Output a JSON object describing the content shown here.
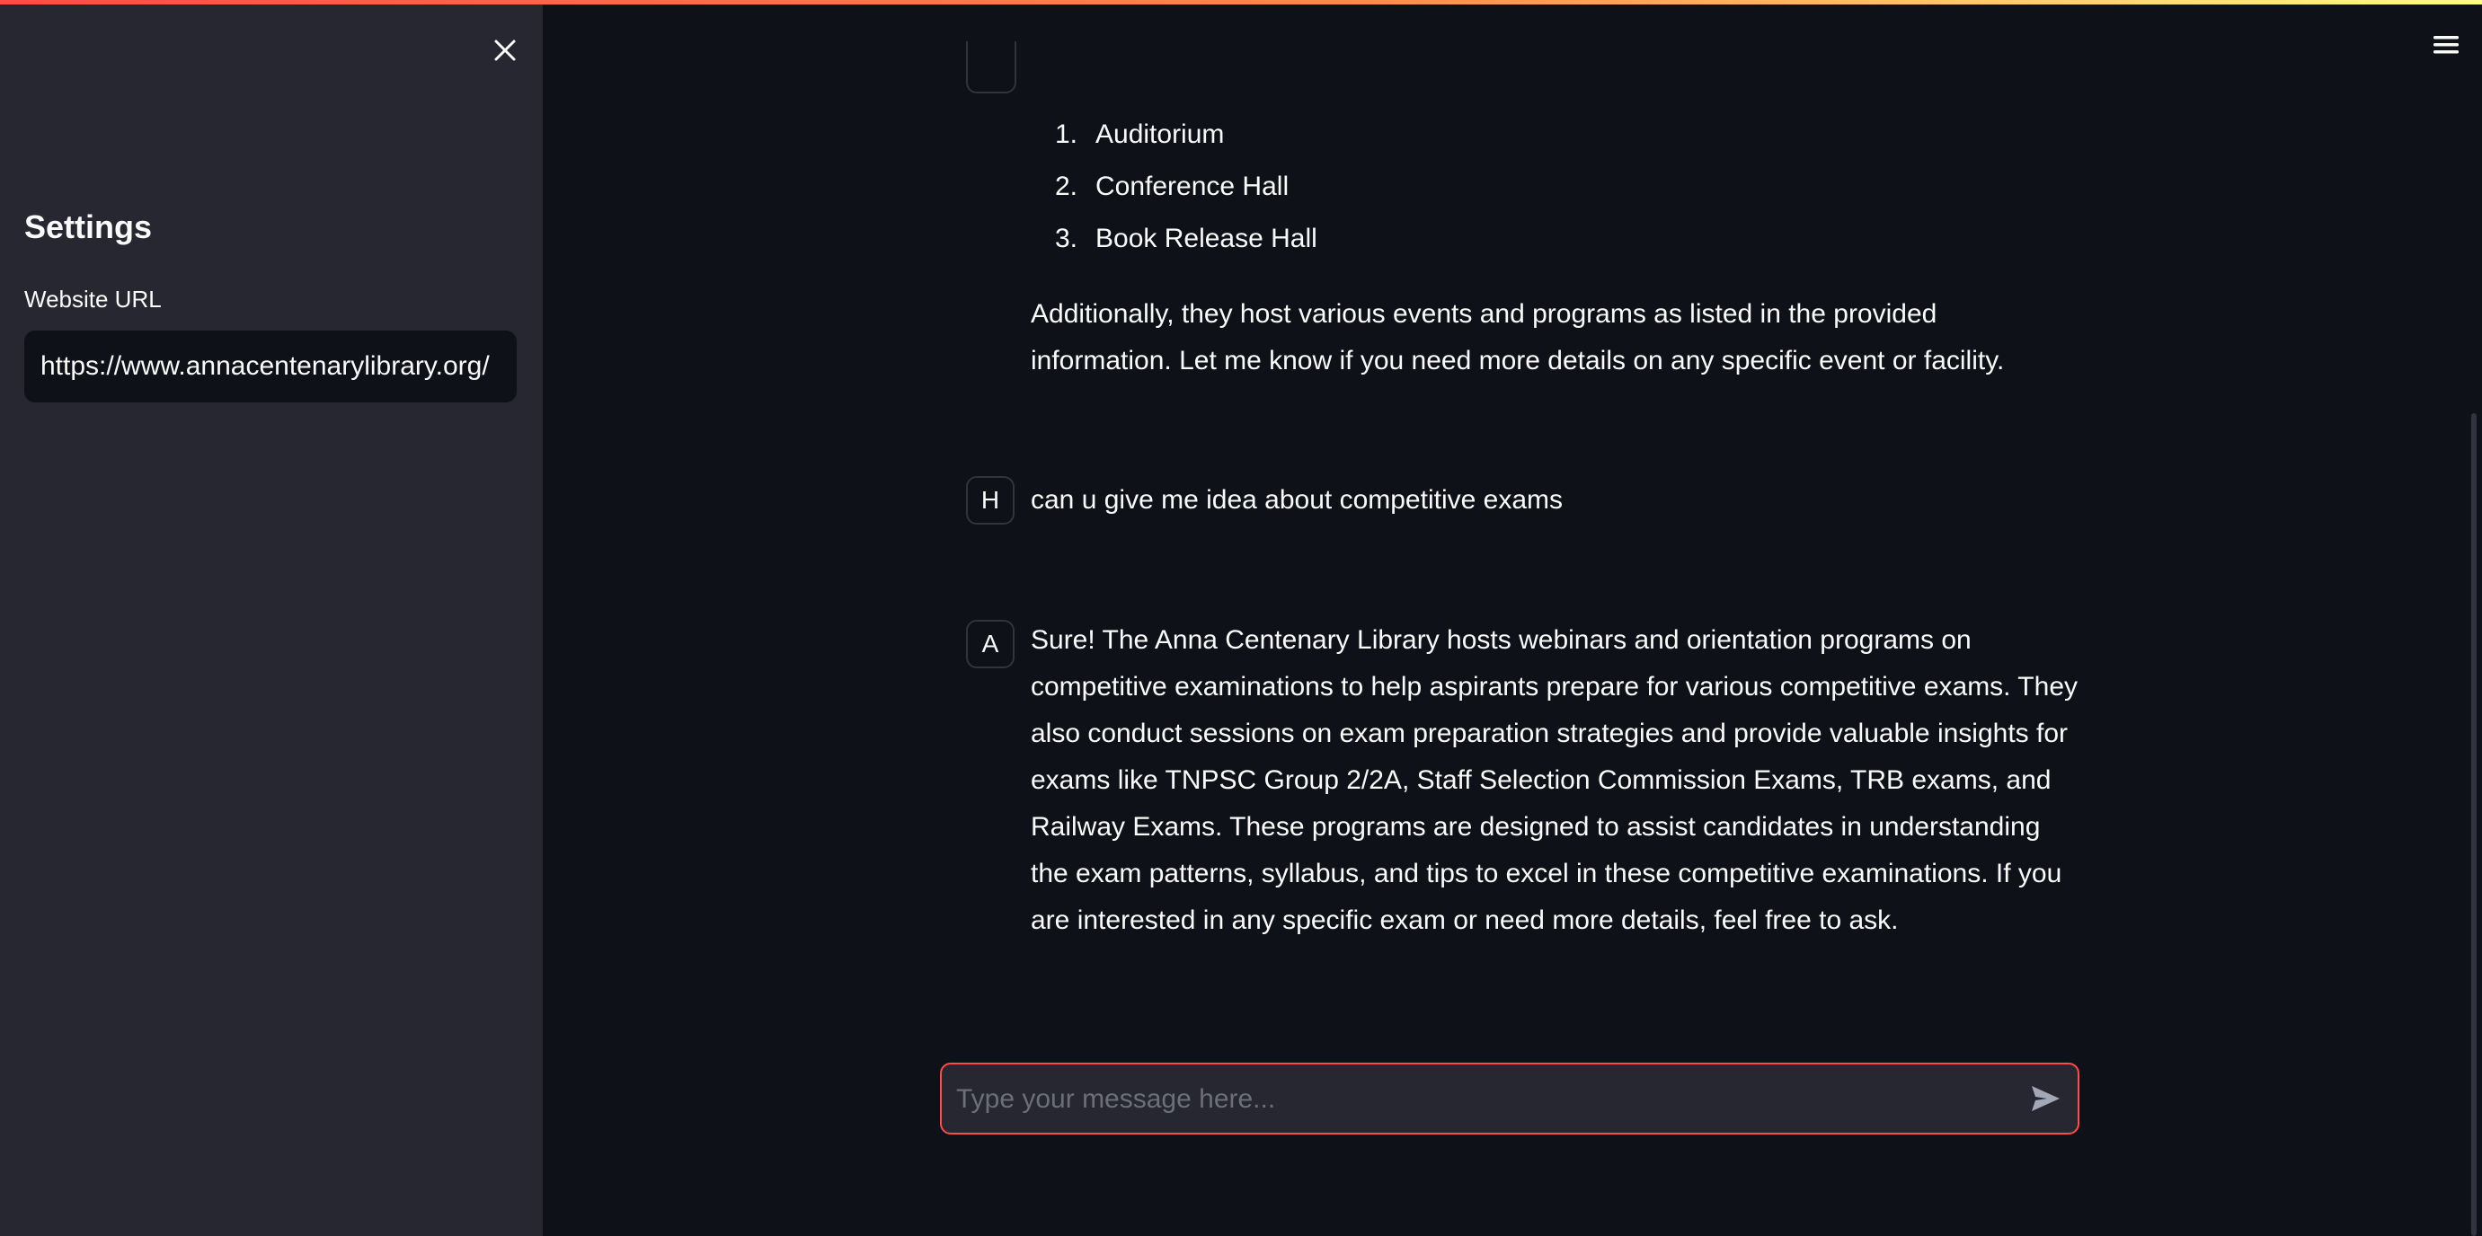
{
  "sidebar": {
    "close_icon": "close-icon",
    "title": "Settings",
    "url_label": "Website URL",
    "url_value": "https://www.annacentenarylibrary.org/"
  },
  "header": {
    "menu_icon": "hamburger-menu-icon"
  },
  "chat": {
    "messages": [
      {
        "role": "assistant",
        "list": [
          {
            "num": "1.",
            "text": "Auditorium"
          },
          {
            "num": "2.",
            "text": "Conference Hall"
          },
          {
            "num": "3.",
            "text": "Book Release Hall"
          }
        ],
        "text": "Additionally, they host various events and programs as listed in the provided information. Let me know if you need more details on any specific event or facility."
      },
      {
        "role": "human",
        "avatar": "H",
        "text": "can u give me idea about competitive exams"
      },
      {
        "role": "assistant",
        "avatar": "A",
        "text": "Sure! The Anna Centenary Library hosts webinars and orientation programs on competitive examinations to help aspirants prepare for various competitive exams. They also conduct sessions on exam preparation strategies and provide valuable insights for exams like TNPSC Group 2/2A, Staff Selection Commission Exams, TRB exams, and Railway Exams. These programs are designed to assist candidates in understanding the exam patterns, syllabus, and tips to excel in these competitive examinations. If you are interested in any specific exam or need more details, feel free to ask."
      }
    ],
    "input_placeholder": "Type your message here...",
    "input_value": "",
    "send_icon": "send-icon"
  },
  "colors": {
    "background": "#0e1117",
    "sidebar": "#262730",
    "accent": "#ff4b4b",
    "text": "#fafafa"
  }
}
